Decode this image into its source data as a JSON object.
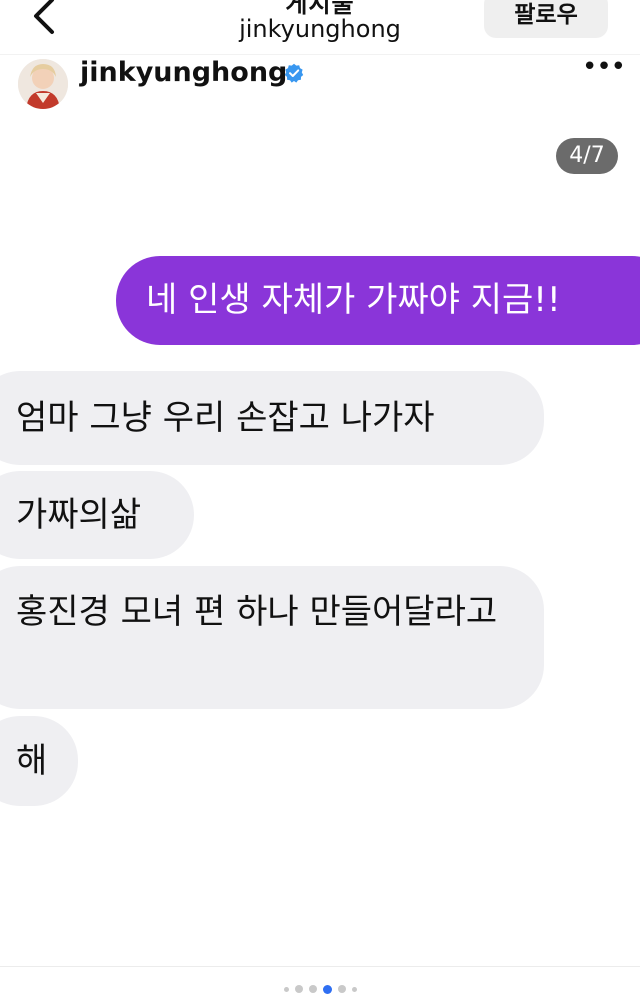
{
  "header": {
    "title": "게시물",
    "subtitle": "jinkyunghong",
    "follow_label": "팔로우"
  },
  "post": {
    "username": "jinkyunghong",
    "verified": true,
    "more_label": "•••",
    "page_counter": "4/7"
  },
  "messages": [
    {
      "direction": "sent",
      "text": "네 인생 자체가 가짜야 지금!!"
    },
    {
      "direction": "received",
      "text": "엄마 그냥 우리 손잡고 나가자"
    },
    {
      "direction": "received",
      "text": "가짜의삶"
    },
    {
      "direction": "received",
      "text": "홍진경 모녀 편 하나 만들어달라고"
    },
    {
      "direction": "received",
      "text": "해"
    }
  ],
  "carousel": {
    "total_slides": 7,
    "active_slide": 4
  },
  "colors": {
    "sent_bubble": "#8a35d9",
    "received_bubble": "#efeff2",
    "verified_badge": "#3897f0",
    "active_dot": "#2f6ff2",
    "counter_badge": "#6b6b6b"
  },
  "icons": {
    "back": "chevron-left-icon",
    "verified": "verified-badge-icon",
    "more": "more-horizontal-icon"
  }
}
